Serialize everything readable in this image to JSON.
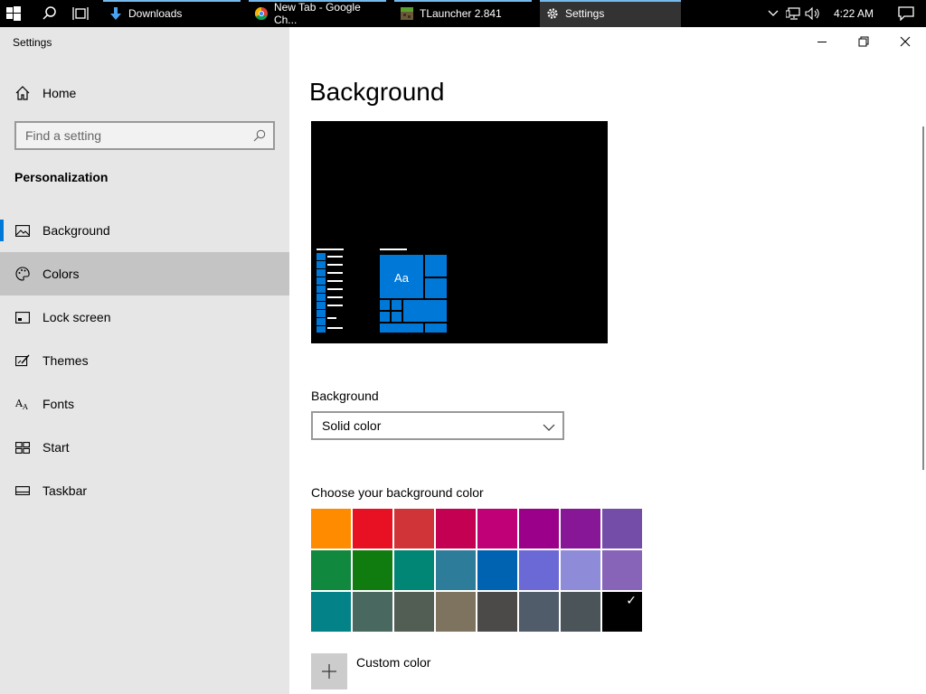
{
  "taskbar": {
    "tasks": [
      {
        "label": "Downloads",
        "icon": "download-arrow-icon"
      },
      {
        "label": "New Tab - Google Ch...",
        "icon": "chrome-icon"
      },
      {
        "label": "TLauncher 2.841",
        "icon": "tlauncher-icon"
      },
      {
        "label": "Settings",
        "icon": "gear-icon"
      }
    ],
    "time": "4:22 AM",
    "accent": "#76b9ed"
  },
  "window": {
    "title": "Settings"
  },
  "sidebar": {
    "home_label": "Home",
    "search_placeholder": "Find a setting",
    "section": "Personalization",
    "items": [
      {
        "label": "Background",
        "icon": "picture-icon"
      },
      {
        "label": "Colors",
        "icon": "palette-icon"
      },
      {
        "label": "Lock screen",
        "icon": "lock-screen-icon"
      },
      {
        "label": "Themes",
        "icon": "themes-icon"
      },
      {
        "label": "Fonts",
        "icon": "fonts-icon"
      },
      {
        "label": "Start",
        "icon": "start-icon"
      },
      {
        "label": "Taskbar",
        "icon": "taskbar-icon"
      }
    ],
    "selected": "Background",
    "hovered": "Colors"
  },
  "main": {
    "title": "Background",
    "preview_tile_text": "Aa",
    "background_label": "Background",
    "background_value": "Solid color",
    "color_label": "Choose your background color",
    "custom_color_label": "Custom color",
    "colors": [
      "#ff8c00",
      "#e81123",
      "#d13438",
      "#c30052",
      "#bf0077",
      "#9a0089",
      "#881798",
      "#744da9",
      "#10893e",
      "#107c10",
      "#018574",
      "#2d7d9a",
      "#0063b1",
      "#6b69d6",
      "#8e8cd8",
      "#8764b8",
      "#038387",
      "#486860",
      "#525e54",
      "#7e735f",
      "#4c4a48",
      "#515c6b",
      "#4a5459",
      "#000000"
    ],
    "selected_color": "#000000",
    "accent": "#0078d7"
  }
}
